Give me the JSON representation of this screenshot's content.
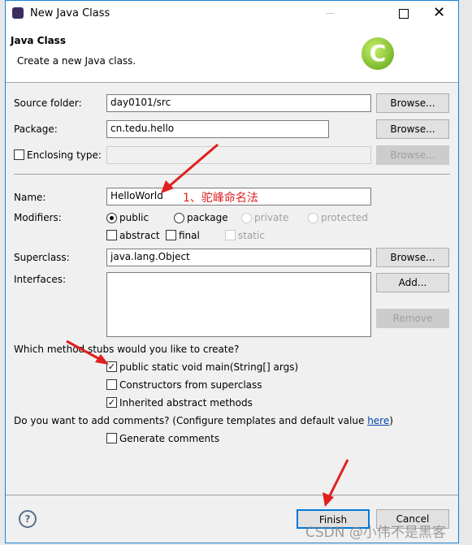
{
  "window": {
    "title": "New Java Class"
  },
  "header": {
    "title": "Java Class",
    "description": "Create a new Java class."
  },
  "form": {
    "source_folder": {
      "label": "Source folder:",
      "value": "day0101/src",
      "browse": "Browse..."
    },
    "package": {
      "label": "Package:",
      "value": "cn.tedu.hello",
      "browse": "Browse..."
    },
    "enclosing": {
      "label": "Enclosing type:",
      "value": "",
      "browse": "Browse...",
      "checked": false
    },
    "name": {
      "label": "Name:",
      "value": "HelloWorld"
    },
    "modifiers": {
      "label": "Modifiers:",
      "public": "public",
      "package": "package",
      "private": "private",
      "protected": "protected",
      "abstract": "abstract",
      "final": "final",
      "static": "static",
      "selected": "public"
    },
    "superclass": {
      "label": "Superclass:",
      "value": "java.lang.Object",
      "browse": "Browse..."
    },
    "interfaces": {
      "label": "Interfaces:",
      "add": "Add...",
      "remove": "Remove"
    },
    "stubs": {
      "question": "Which method stubs would you like to create?",
      "main": "public static void main(String[] args)",
      "constructors": "Constructors from superclass",
      "inherited": "Inherited abstract methods",
      "main_checked": true,
      "constructors_checked": false,
      "inherited_checked": true
    },
    "comments": {
      "question": "Do you want to add comments? (Configure templates and default value ",
      "link": "here",
      "suffix": ")",
      "generate": "Generate comments",
      "checked": false
    }
  },
  "footer": {
    "finish": "Finish",
    "cancel": "Cancel"
  },
  "annotation": {
    "text": "1、驼峰命名法",
    "color": "#e02020"
  },
  "watermark": "CSDN @小伟不是黑客"
}
